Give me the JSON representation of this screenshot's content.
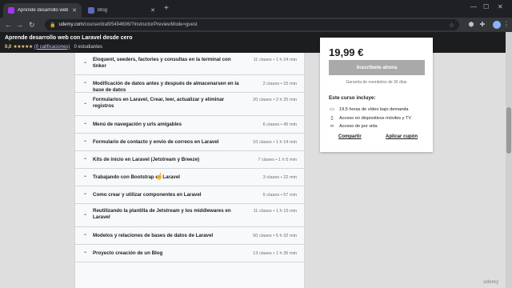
{
  "browser": {
    "tabs": [
      {
        "title": "Aprende desarrollo web con Larav…",
        "favicon_color": "#a435f0"
      },
      {
        "title": "Blog",
        "favicon_color": "#5c6bc0"
      }
    ],
    "url_host": "udemy.com",
    "url_path": "/course/draft/5494606/?instructorPreviewMode=guest"
  },
  "course": {
    "title": "Aprende desarrollo web con Laravel desde cero",
    "rating_score": "0,0",
    "rating_link": "(0 calificaciones)",
    "students": "0 estudiantes"
  },
  "curriculum": [
    {
      "title": "Eloquent, seeders, factories y consultas en la terminal con tinker",
      "meta": "11 clases • 1 h 24 min"
    },
    {
      "title": "Modificación de datos antes y después de almacenarsen en la base de datos",
      "meta": "2 clases • 15 min"
    },
    {
      "title": "Formularios en Laravel, Crear, leer, actualizar y eliminar registros",
      "meta": "20 clases • 2 h 25 min"
    },
    {
      "title": "Menú de navegación y urls amigables",
      "meta": "6 clases • 45 min"
    },
    {
      "title": "Formulario de contacto y envío de correos en Laravel",
      "meta": "10 clases • 1 h 14 min"
    },
    {
      "title": "Kits de inicio en Laravel (Jetstream y Breeze)",
      "meta": "7 clases • 1 h 5 min"
    },
    {
      "title": "Trabajando con Bootstrap en Laravel",
      "meta": "3 clases • 22 min"
    },
    {
      "title": "Como crear y utilizar componentes en Laravel",
      "meta": "5 clases • 57 min"
    },
    {
      "title": "Reutilizando la plantilla de Jetstream y los middlewares en Laravel",
      "meta": "11 clases • 1 h 15 min"
    },
    {
      "title": "Modelos y relaciones de bases de datos de Laravel",
      "meta": "50 clases • 5 h 32 min"
    },
    {
      "title": "Proyecto creación de un Blog",
      "meta": "13 clases • 1 h 35 min"
    }
  ],
  "purchase": {
    "price": "19,99 €",
    "enroll_label": "Inscríbete ahora",
    "guarantee": "Garantía de reembolso de 30 días",
    "includes_title": "Este curso incluye:",
    "includes": [
      {
        "icon": "video-icon",
        "text": "19,5 horas de vídeo bajo demanda"
      },
      {
        "icon": "mobile-tv-icon",
        "text": "Acceso en dispositivos móviles y TV"
      },
      {
        "icon": "infinity-icon",
        "text": "Acceso de por vida"
      }
    ],
    "share_label": "Compartir",
    "coupon_label": "Aplicar cupón"
  },
  "watermark": "udemy"
}
